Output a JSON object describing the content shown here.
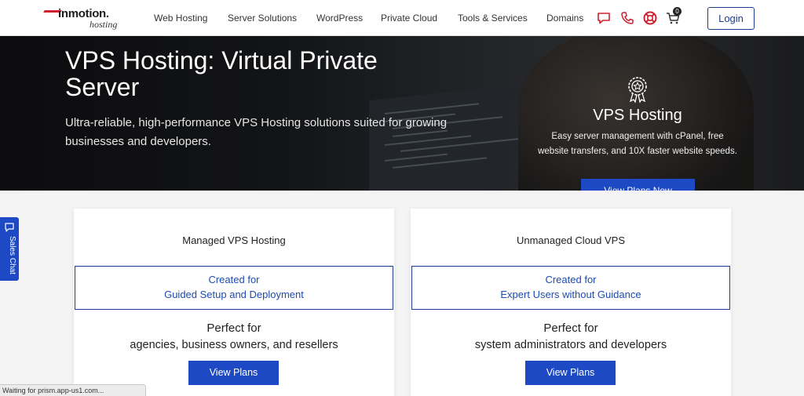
{
  "header": {
    "logo": {
      "brand": "inmotion.",
      "sub": "hosting"
    },
    "nav": [
      "Web Hosting",
      "Server Solutions",
      "WordPress",
      "Private Cloud",
      "Tools & Services",
      "Domains"
    ],
    "icons": [
      "chat-icon",
      "phone-icon",
      "support-icon",
      "cart-icon"
    ],
    "cart_count": "0",
    "login_label": "Login"
  },
  "hero": {
    "title": "VPS Hosting: Virtual Private Server",
    "subtitle": "Ultra-reliable, high-performance VPS Hosting solutions suited for growing businesses and developers.",
    "side_title": "VPS Hosting",
    "side_text": "Easy server management with cPanel, free website transfers, and 10X faster website speeds.",
    "cta_label": "View Plans Now"
  },
  "cards": [
    {
      "title": "Managed VPS Hosting",
      "box_line1": "Created for",
      "box_line2": "Guided Setup and Deployment",
      "perfect": "Perfect for",
      "audience": "agencies, business owners, and resellers",
      "button": "View Plans"
    },
    {
      "title": "Unmanaged Cloud VPS",
      "box_line1": "Created for",
      "box_line2": "Expert Users without Guidance",
      "perfect": "Perfect for",
      "audience": "system administrators and developers",
      "button": "View Plans"
    }
  ],
  "sales_tab": {
    "label": "Sales Chat"
  },
  "status_text": "Waiting for prism.app-us1.com...",
  "colors": {
    "accent": "#1d49c4",
    "brand_red": "#d0202e",
    "border_blue": "#1d3d91",
    "link_blue": "#1d4bb0"
  }
}
